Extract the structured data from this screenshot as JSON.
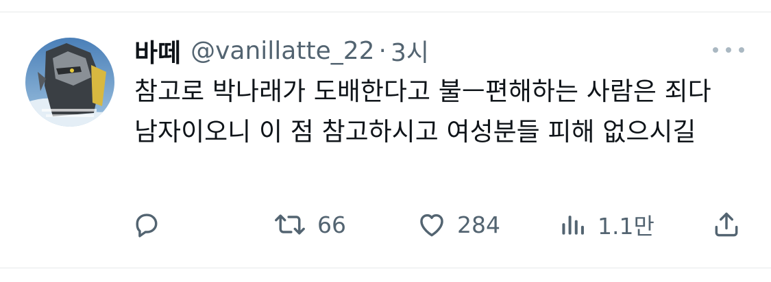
{
  "tweet": {
    "display_name": "바떼",
    "handle": "@vanillatte_22",
    "separator": "·",
    "time": "3시",
    "text": "참고로 박나래가 도배한다고 불ㅡ편해하는 사람은 죄다 남자이오니 이 점 참고하시고 여성분들 피해 없으시길"
  },
  "actions": {
    "retweets": "66",
    "likes": "284",
    "views": "1.1만"
  },
  "colors": {
    "text": "#0f1419",
    "secondary": "#536471",
    "divider": "#e7e9ea"
  },
  "icons": {
    "reply": "reply-icon",
    "retweet": "retweet-icon",
    "like": "heart-icon",
    "views": "views-icon",
    "share": "share-icon",
    "more": "more-icon"
  }
}
